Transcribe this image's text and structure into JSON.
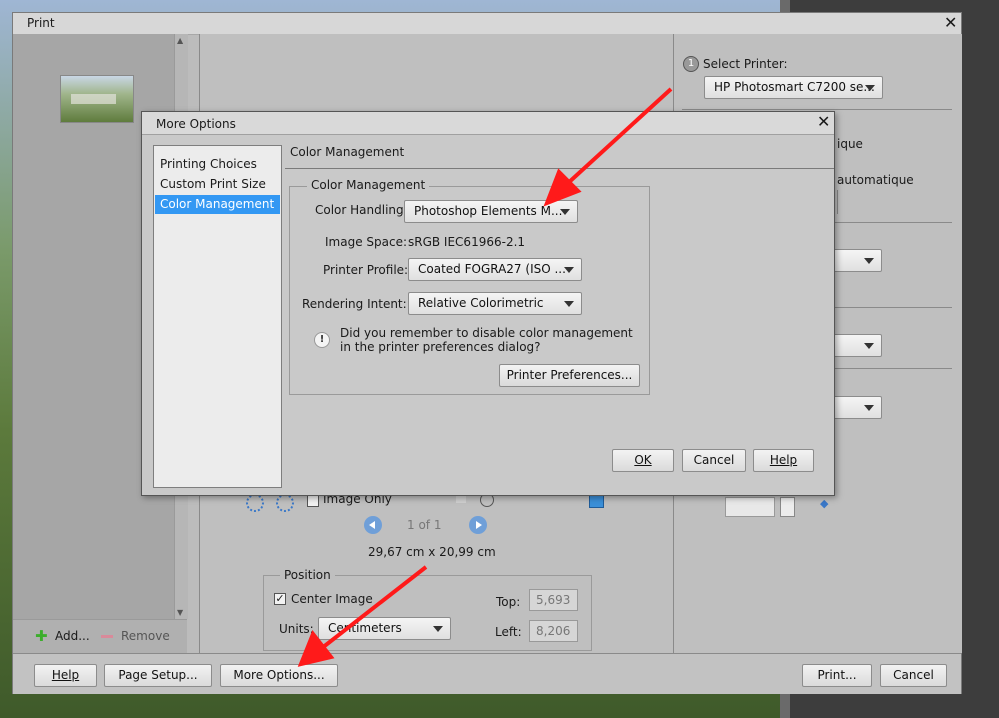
{
  "print_window": {
    "title": "Print",
    "add_label": "Add...",
    "remove_label": "Remove",
    "page_info": "1 of 1",
    "page_size": "29,67 cm x 20,99 cm",
    "image_only_label": "Image Only",
    "position": {
      "group_label": "Position",
      "center_image_label": "Center Image",
      "center_image_checked": true,
      "units_label": "Units:",
      "units_value": "Centimeters",
      "top_label": "Top:",
      "top_value": "5,693",
      "left_label": "Left:",
      "left_value": "8,206"
    },
    "buttons": {
      "help": "Help",
      "page_setup": "Page Setup...",
      "more_options": "More Options...",
      "print": "Print...",
      "cancel": "Cancel"
    },
    "right_panel": {
      "step_number": "1",
      "select_printer_label": "Select Printer:",
      "printer_value": "HP Photosmart C7200 se...",
      "partial_text_1": "ique",
      "partial_text_2": "automatique"
    }
  },
  "more_options": {
    "title": "More Options",
    "nav_items": [
      "Printing Choices",
      "Custom Print Size",
      "Color Management"
    ],
    "selected_index": 2,
    "section_header": "Color Management",
    "group_label": "Color Management",
    "color_handling_label": "Color Handling:",
    "color_handling_value": "Photoshop Elements M...",
    "image_space_label": "Image Space:",
    "image_space_value": "sRGB IEC61966-2.1",
    "printer_profile_label": "Printer Profile:",
    "printer_profile_value": "Coated FOGRA27 (ISO ...",
    "rendering_intent_label": "Rendering Intent:",
    "rendering_intent_value": "Relative Colorimetric",
    "warning_line1": "Did you remember to disable color management",
    "warning_line2": "in the printer preferences dialog?",
    "printer_prefs_button": "Printer Preferences...",
    "ok_button": "OK",
    "cancel_button": "Cancel",
    "help_button": "Help"
  },
  "colors": {
    "selection": "#3398f3",
    "annotation_arrow": "#ff1a1a",
    "add_icon": "#3cae2c",
    "remove_icon": "#d98a9a"
  }
}
